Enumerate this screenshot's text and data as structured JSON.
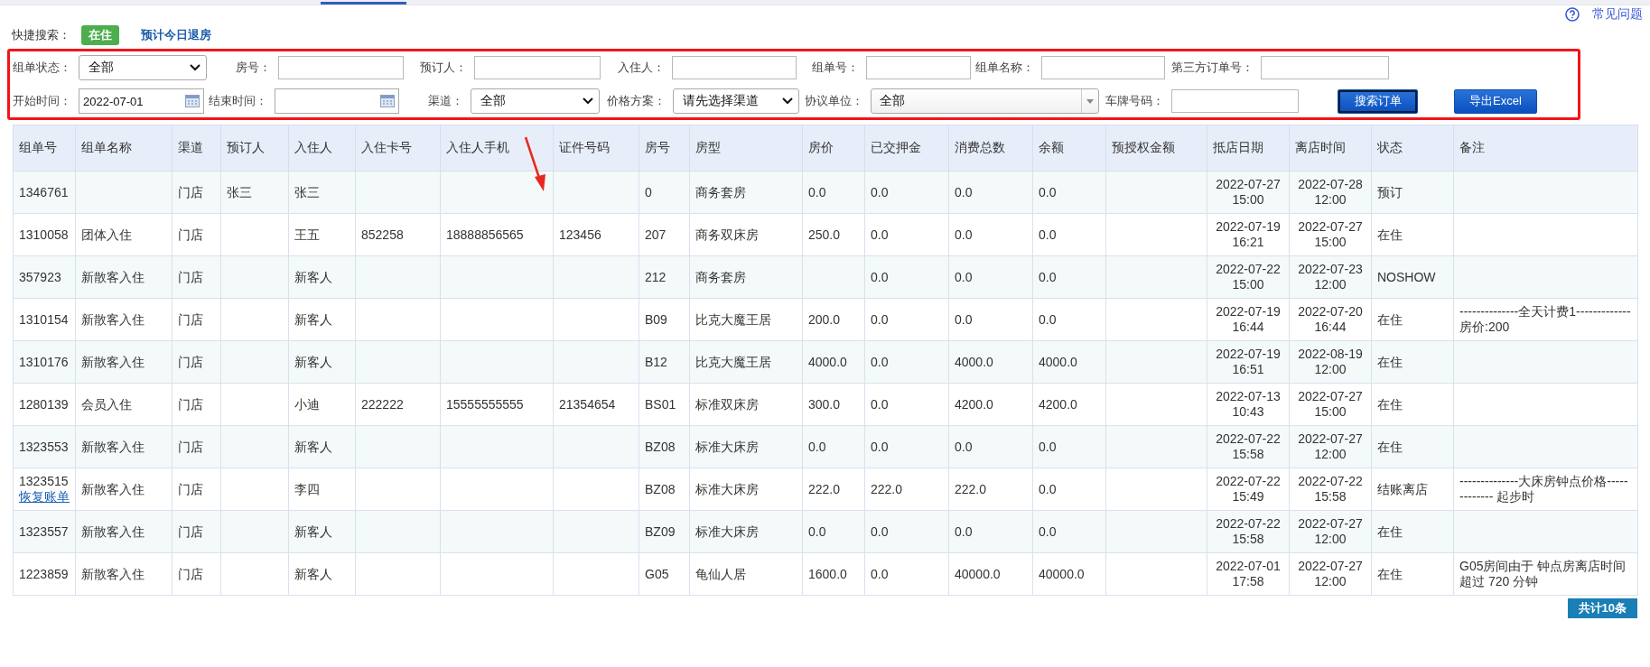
{
  "help_link": "常见问题",
  "quick_search": {
    "label": "快捷搜索：",
    "items": [
      {
        "label": "在住",
        "selected": true
      },
      {
        "label": "预计今日退房",
        "selected": false
      }
    ]
  },
  "filters": [
    [
      {
        "kind": "select",
        "label": "组单状态：",
        "value": "全部"
      },
      {
        "kind": "text",
        "label": "房号："
      },
      {
        "kind": "text",
        "label": "预订人："
      },
      {
        "kind": "text",
        "label": "入住人："
      },
      {
        "kind": "text",
        "label": "组单号："
      },
      {
        "kind": "text",
        "label": "组单名称："
      },
      {
        "kind": "text",
        "label": "第三方订单号："
      }
    ],
    [
      {
        "kind": "date",
        "label": "开始时间：",
        "value": "2022-07-01"
      },
      {
        "kind": "date",
        "label": "结束时间："
      },
      {
        "kind": "select",
        "label": "渠道：",
        "value": "全部"
      },
      {
        "kind": "select",
        "label": "价格方案：",
        "value": "请先选择渠道"
      },
      {
        "kind": "combo",
        "label": "协议单位：",
        "value": "全部"
      },
      {
        "kind": "text",
        "label": "车牌号码："
      }
    ]
  ],
  "buttons": [
    {
      "label": "搜索订单",
      "focused": true
    },
    {
      "label": "导出Excel",
      "focused": false
    }
  ],
  "table": {
    "columns": [
      "组单号",
      "组单名称",
      "渠道",
      "预订人",
      "入住人",
      "入住卡号",
      "入住人手机",
      "证件号码",
      "房号",
      "房型",
      "房价",
      "已交押金",
      "消费总数",
      "余额",
      "预授权金额",
      "抵店日期",
      "离店时间",
      "状态",
      "备注"
    ],
    "rows": [
      {
        "cells": [
          "1346761",
          "",
          "门店",
          "张三",
          "张三",
          "",
          "",
          "",
          "0",
          "商务套房",
          "0.0",
          "0.0",
          "0.0",
          "0.0",
          "",
          "2022-07-27 15:00",
          "2022-07-28 12:00",
          "预订",
          ""
        ]
      },
      {
        "cells": [
          "1310058",
          "团体入住",
          "门店",
          "",
          "王五",
          "852258",
          "18888856565",
          "123456",
          "207",
          "商务双床房",
          "250.0",
          "0.0",
          "0.0",
          "0.0",
          "",
          "2022-07-19 16:21",
          "2022-07-27 15:00",
          "在住",
          ""
        ]
      },
      {
        "cells": [
          "357923",
          "新散客入住",
          "门店",
          "",
          "新客人",
          "",
          "",
          "",
          "212",
          "商务套房",
          "",
          "0.0",
          "0.0",
          "0.0",
          "",
          "2022-07-22 15:00",
          "2022-07-23 12:00",
          "NOSHOW",
          ""
        ]
      },
      {
        "cells": [
          "1310154",
          "新散客入住",
          "门店",
          "",
          "新客人",
          "",
          "",
          "",
          "B09",
          "比克大魔王居",
          "200.0",
          "0.0",
          "0.0",
          "0.0",
          "",
          "2022-07-19 16:44",
          "2022-07-20 16:44",
          "在住",
          "--------------全天计费1------------- 房价:200"
        ]
      },
      {
        "cells": [
          "1310176",
          "新散客入住",
          "门店",
          "",
          "新客人",
          "",
          "",
          "",
          "B12",
          "比克大魔王居",
          "4000.0",
          "0.0",
          "4000.0",
          "4000.0",
          "",
          "2022-07-19 16:51",
          "2022-08-19 12:00",
          "在住",
          ""
        ]
      },
      {
        "cells": [
          "1280139",
          "会员入住",
          "门店",
          "",
          "小迪",
          "222222",
          "15555555555",
          "21354654",
          "BS01",
          "标准双床房",
          "300.0",
          "0.0",
          "4200.0",
          "4200.0",
          "",
          "2022-07-13 10:43",
          "2022-07-27 15:00",
          "在住",
          ""
        ]
      },
      {
        "cells": [
          "1323553",
          "新散客入住",
          "门店",
          "",
          "新客人",
          "",
          "",
          "",
          "BZ08",
          "标准大床房",
          "0.0",
          "0.0",
          "0.0",
          "0.0",
          "",
          "2022-07-22 15:58",
          "2022-07-27 12:00",
          "在住",
          ""
        ]
      },
      {
        "cells": [
          "1323515",
          "新散客入住",
          "门店",
          "",
          "李四",
          "",
          "",
          "",
          "BZ08",
          "标准大床房",
          "222.0",
          "222.0",
          "222.0",
          "0.0",
          "",
          "2022-07-22 15:49",
          "2022-07-22 15:58",
          "结账离店",
          "--------------大床房钟点价格------------- 起步时"
        ],
        "link": "恢复账单"
      },
      {
        "cells": [
          "1323557",
          "新散客入住",
          "门店",
          "",
          "新客人",
          "",
          "",
          "",
          "BZ09",
          "标准大床房",
          "0.0",
          "0.0",
          "0.0",
          "0.0",
          "",
          "2022-07-22 15:58",
          "2022-07-27 12:00",
          "在住",
          ""
        ]
      },
      {
        "cells": [
          "1223859",
          "新散客入住",
          "门店",
          "",
          "新客人",
          "",
          "",
          "",
          "G05",
          "龟仙人居",
          "1600.0",
          "0.0",
          "40000.0",
          "40000.0",
          "",
          "2022-07-01 17:58",
          "2022-07-27 12:00",
          "在住",
          "G05房间由于 钟点房离店时间超过 720 分钟"
        ]
      }
    ]
  },
  "total": "共计10条"
}
